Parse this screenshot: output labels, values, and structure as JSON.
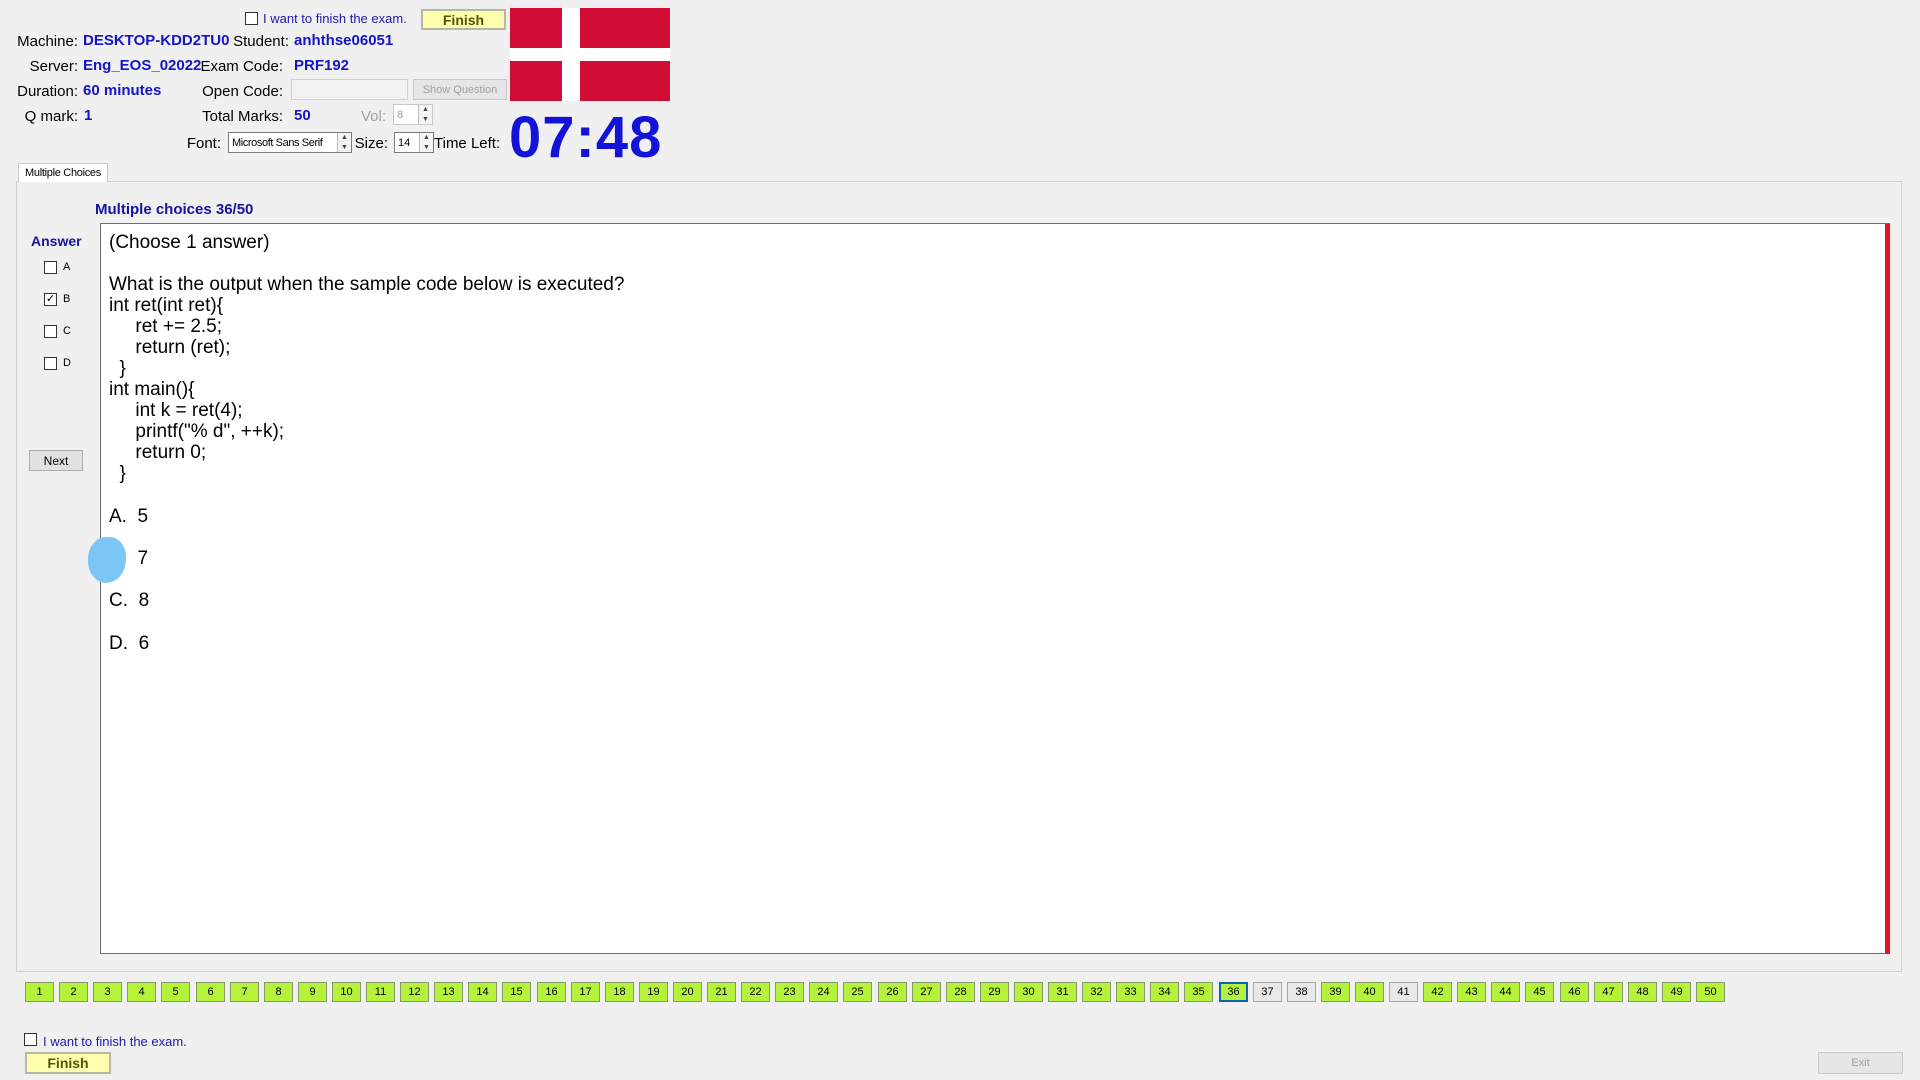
{
  "header": {
    "finish_checkbox_label": "I want to finish the exam.",
    "finish_button": "Finish",
    "machine_label": "Machine:",
    "machine_value": "DESKTOP-KDD2TU0",
    "student_label": "Student:",
    "student_value": "anhthse06051",
    "server_label": "Server:",
    "server_value": "Eng_EOS_02022",
    "exam_code_label": "Exam Code:",
    "exam_code_value": "PRF192",
    "duration_label": "Duration:",
    "duration_value": "60 minutes",
    "open_code_label": "Open Code:",
    "open_code_value": "",
    "show_question_button": "Show Question",
    "qmark_label": "Q mark:",
    "qmark_value": "1",
    "total_marks_label": "Total Marks:",
    "total_marks_value": "50",
    "vol_label": "Vol:",
    "vol_value": "8",
    "font_label": "Font:",
    "font_value": "Microsoft Sans Serif",
    "size_label": "Size:",
    "size_value": "14",
    "time_left_label": "Time Left:",
    "timer": "07:48",
    "flag_colors": {
      "red": "#d10c35",
      "white": "#ffffff"
    }
  },
  "tabs": [
    {
      "label": "Multiple Choices"
    }
  ],
  "question": {
    "counter": "Multiple choices 36/50",
    "lines": [
      "(Choose 1 answer)",
      "",
      "What is the output when the sample code below is executed?",
      "int ret(int ret){",
      "     ret += 2.5;",
      "     return (ret);",
      "  }",
      "int main(){",
      "     int k = ret(4);",
      "     printf(\"% d\", ++k);",
      "     return 0;",
      "  }"
    ],
    "options": [
      {
        "letter": "A.",
        "text": "5"
      },
      {
        "letter": "B.",
        "text": "7"
      },
      {
        "letter": "C.",
        "text": "8"
      },
      {
        "letter": "D.",
        "text": "6"
      }
    ]
  },
  "answer_panel": {
    "title": "Answer",
    "choices": [
      {
        "label": "A",
        "checked": false
      },
      {
        "label": "B",
        "checked": true
      },
      {
        "label": "C",
        "checked": false
      },
      {
        "label": "D",
        "checked": false
      }
    ],
    "next_button": "Next"
  },
  "navigator": {
    "total": 50,
    "current": 36,
    "unanswered": [
      37,
      38,
      41
    ],
    "answered_color": "#b4f23c",
    "labels": [
      "1",
      "2",
      "3",
      "4",
      "5",
      "6",
      "7",
      "8",
      "9",
      "10",
      "11",
      "12",
      "13",
      "14",
      "15",
      "16",
      "17",
      "18",
      "19",
      "20",
      "21",
      "22",
      "23",
      "24",
      "25",
      "26",
      "27",
      "28",
      "29",
      "30",
      "31",
      "32",
      "33",
      "34",
      "35",
      "36",
      "37",
      "38",
      "39",
      "40",
      "41",
      "42",
      "43",
      "44",
      "45",
      "46",
      "47",
      "48",
      "49",
      "50"
    ]
  },
  "footer": {
    "finish_checkbox_label": "I want to finish the exam.",
    "finish_button": "Finish",
    "exit_button": "Exit"
  }
}
